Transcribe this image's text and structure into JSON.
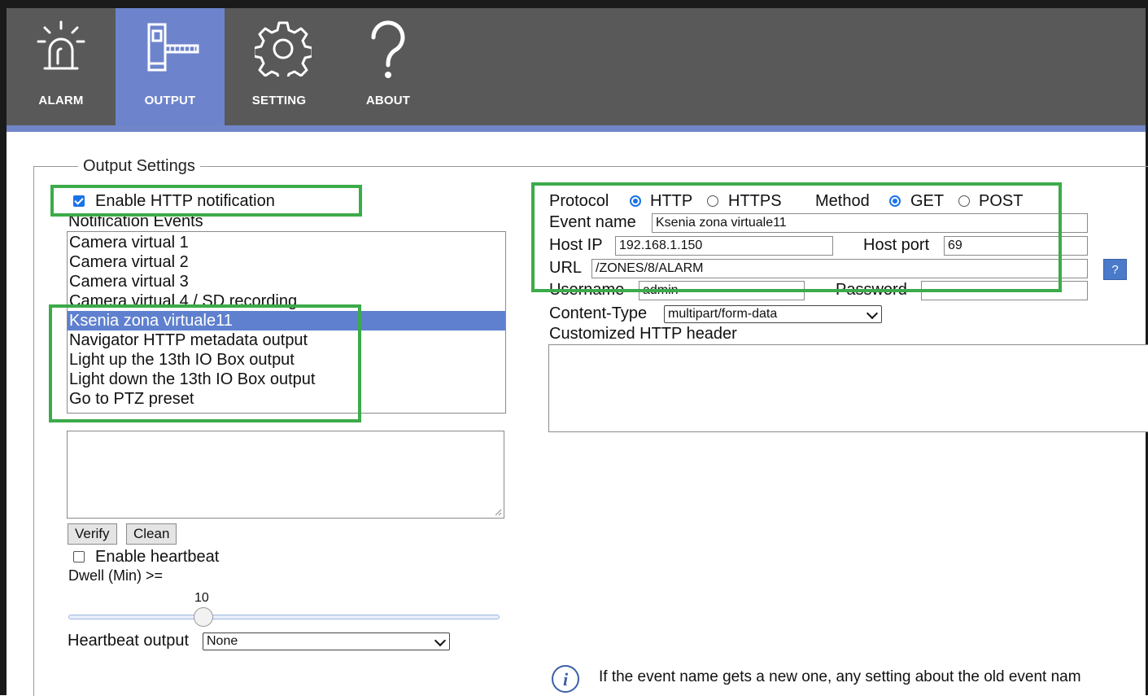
{
  "nav": {
    "tabs": [
      {
        "label": "ALARM",
        "icon": "alarm-light-icon"
      },
      {
        "label": "OUTPUT",
        "icon": "barrier-gate-icon",
        "active": true
      },
      {
        "label": "SETTING",
        "icon": "gear-icon"
      },
      {
        "label": "ABOUT",
        "icon": "question-mark-icon"
      }
    ]
  },
  "output": {
    "legend": "Output Settings",
    "enable_http_label": "Enable HTTP notification",
    "enable_http_checked": true,
    "events_label": "Notification Events",
    "events": [
      "Camera virtual 1",
      "Camera virtual 2",
      "Camera virtual 3",
      "Camera virtual 4 / SD recording",
      "Ksenia zona virtuale11",
      "Navigator HTTP metadata output",
      "Light up the 13th IO Box output",
      "Light down the 13th IO Box output",
      "Go to PTZ preset"
    ],
    "selected_event": "Ksenia zona virtuale11",
    "verify_label": "Verify",
    "clean_label": "Clean",
    "heartbeat_label": "Enable heartbeat",
    "heartbeat_checked": false,
    "dwell_label": "Dwell (Min) >=",
    "dwell_value": "10",
    "heartbeat_output_label": "Heartbeat output",
    "heartbeat_output_value": "None"
  },
  "http": {
    "protocol_label": "Protocol",
    "protocol_http": "HTTP",
    "protocol_https": "HTTPS",
    "protocol_selected": "HTTP",
    "method_label": "Method",
    "method_get": "GET",
    "method_post": "POST",
    "method_selected": "GET",
    "event_name_label": "Event name",
    "event_name_value": "Ksenia zona virtuale11",
    "host_ip_label": "Host IP",
    "host_ip_value": "192.168.1.150",
    "host_port_label": "Host port",
    "host_port_value": "69",
    "url_label": "URL",
    "url_value": "/ZONES/8/ALARM",
    "url_help": "?",
    "username_label": "Username",
    "username_value": "admin",
    "password_label": "Password",
    "password_value": "·······",
    "content_type_label": "Content-Type",
    "content_type_value": "multipart/form-data",
    "custom_header_label": "Customized HTTP header"
  },
  "info": {
    "text": "If the event name gets a new one, any setting about the old event nam"
  },
  "colors": {
    "nav_bg": "#595959",
    "nav_active": "#6d84cc",
    "highlight_box": "#3cab4a",
    "selection": "#5f80cf"
  }
}
